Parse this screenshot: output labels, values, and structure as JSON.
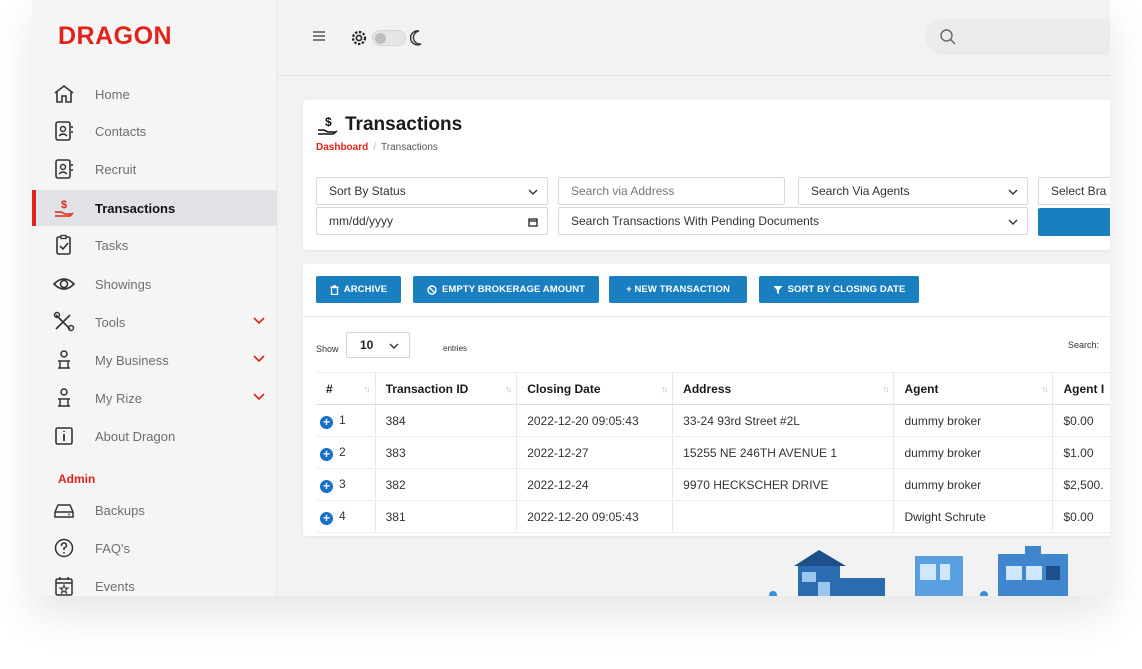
{
  "brand": {
    "logo": "DRAGON",
    "accent": "#e2231a",
    "primary": "#1a7fc1"
  },
  "sidebar": {
    "items": [
      {
        "label": "Home",
        "icon": "home-icon"
      },
      {
        "label": "Contacts",
        "icon": "contact-card-icon"
      },
      {
        "label": "Recruit",
        "icon": "contact-card-icon"
      },
      {
        "label": "Transactions",
        "icon": "money-hand-icon",
        "active": true
      },
      {
        "label": "Tasks",
        "icon": "clipboard-check-icon"
      },
      {
        "label": "Showings",
        "icon": "eye-icon"
      },
      {
        "label": "Tools",
        "icon": "tools-icon",
        "expandable": true
      },
      {
        "label": "My Business",
        "icon": "person-desk-icon",
        "expandable": true
      },
      {
        "label": "My Rize",
        "icon": "person-desk-icon",
        "expandable": true
      },
      {
        "label": "About Dragon",
        "icon": "info-icon"
      }
    ],
    "admin_heading": "Admin",
    "admin_items": [
      {
        "label": "Backups",
        "icon": "hard-drive-icon"
      },
      {
        "label": "FAQ's",
        "icon": "question-circle-icon"
      },
      {
        "label": "Events",
        "icon": "calendar-star-icon"
      }
    ]
  },
  "topbar": {
    "search_placeholder": ""
  },
  "page": {
    "title": "Transactions",
    "breadcrumb": [
      "Dashboard",
      "Transactions"
    ]
  },
  "filters": {
    "sort_by_status": "Sort By Status",
    "date_placeholder": "mm/dd/yyyy",
    "search_address_placeholder": "Search via Address",
    "search_agents": "Search Via Agents",
    "select_branch": "Select Bra",
    "pending_documents": "Search Transactions With Pending Documents"
  },
  "toolbar": {
    "archive": "ARCHIVE",
    "empty_brokerage": "EMPTY BROKERAGE AMOUNT",
    "new_transaction": "+ NEW TRANSACTION",
    "sort_closing": "SORT BY CLOSING DATE"
  },
  "table_controls": {
    "show": "Show",
    "length": "10",
    "entries": "entries",
    "search": "Search:"
  },
  "table": {
    "columns": [
      "#",
      "Transaction ID",
      "Closing Date",
      "Address",
      "Agent",
      "Agent I"
    ],
    "rows": [
      {
        "n": "1",
        "id": "384",
        "date": "2022-12-20 09:05:43",
        "address": "33-24 93rd Street #2L",
        "agent": "dummy broker",
        "amount": "$0.00"
      },
      {
        "n": "2",
        "id": "383",
        "date": "2022-12-27",
        "address": "15255 NE 246TH AVENUE 1",
        "agent": "dummy broker",
        "amount": "$1.00"
      },
      {
        "n": "3",
        "id": "382",
        "date": "2022-12-24",
        "address": "9970 HECKSCHER DRIVE",
        "agent": "dummy broker",
        "amount": "$2,500."
      },
      {
        "n": "4",
        "id": "381",
        "date": "2022-12-20 09:05:43",
        "address": "",
        "agent": "Dwight Schrute",
        "amount": "$0.00"
      }
    ]
  }
}
